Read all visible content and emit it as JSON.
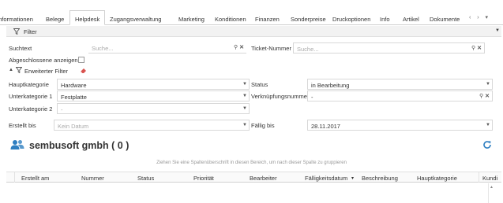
{
  "tabs": [
    {
      "label": "Informationen",
      "active": false
    },
    {
      "label": "Belege",
      "active": false
    },
    {
      "label": "Helpdesk",
      "active": true
    },
    {
      "label": "Zugangsverwaltung",
      "active": false
    },
    {
      "label": "Marketing",
      "active": false
    },
    {
      "label": "Konditionen",
      "active": false
    },
    {
      "label": "Finanzen",
      "active": false
    },
    {
      "label": "Sonderpreise",
      "active": false
    },
    {
      "label": "Druckoptionen",
      "active": false
    },
    {
      "label": "Info",
      "active": false
    },
    {
      "label": "Artikel",
      "active": false
    },
    {
      "label": "Dokumente",
      "active": false
    }
  ],
  "tab_scroll": "‹ › ▾",
  "filter": {
    "title": "Filter",
    "search_label": "Suchtext",
    "search_placeholder": "Suche...",
    "ticket_label": "Ticket-Nummer",
    "ticket_placeholder": "Suche...",
    "closed_label": "Abgeschlossene anzeigen",
    "extended_label": "Erweiterter Filter",
    "main_cat_label": "Hauptkategorie",
    "main_cat_value": "Hardware",
    "sub1_label": "Unterkategorie 1",
    "sub1_value": "Festplatte",
    "sub2_label": "Unterkategorie 2",
    "sub2_value": "-",
    "status_label": "Status",
    "status_value": "in Bearbeitung",
    "link_label": "Verknüpfungsnummer",
    "link_value": "-",
    "created_label": "Erstellt bis",
    "created_placeholder": "Kein Datum",
    "due_label": "Fällig bis",
    "due_value": "28.11.2017"
  },
  "customer": {
    "name": "sembusoft gmbh ( 0 )"
  },
  "grid": {
    "group_hint": "Ziehen Sie eine Spaltenüberschrift in diesen Bereich, um nach dieser Spalte zu gruppieren",
    "columns": [
      "Erstellt am",
      "Nummer",
      "Status",
      "Priorität",
      "Bearbeiter",
      "Fälligkeitsdatum",
      "Beschreibung",
      "Hauptkategorie",
      "Kundi"
    ],
    "sort_indicator": "▾"
  },
  "colors": {
    "accent": "#2f7fc1",
    "eraser": "#d9534f"
  },
  "icons": {
    "filter": "funnel-icon",
    "clear": "eraser-icon",
    "search": "magnifier-icon",
    "clear_field": "x-icon",
    "customer": "users-icon",
    "refresh": "refresh-icon"
  }
}
